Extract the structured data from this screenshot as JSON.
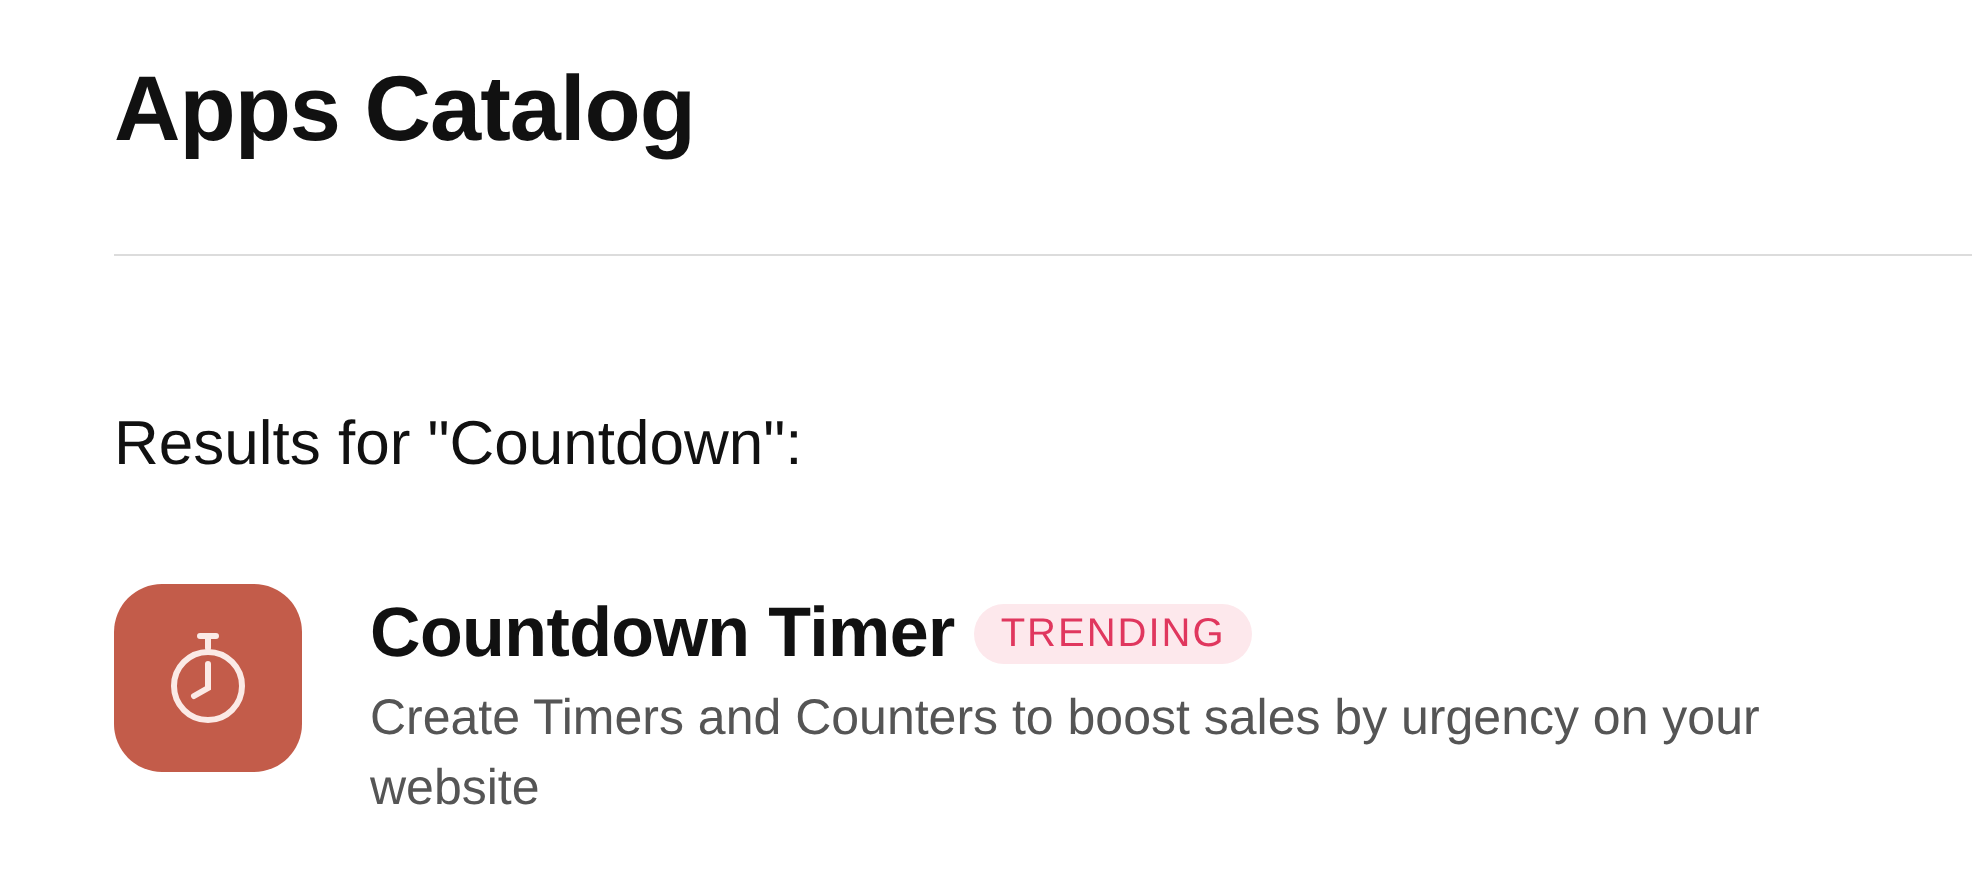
{
  "page": {
    "title": "Apps Catalog"
  },
  "results": {
    "heading": "Results for \"Countdown\":",
    "apps": [
      {
        "name": "Countdown Timer",
        "badge": "TRENDING",
        "description": "Create Timers and Counters to boost sales by urgency on your website"
      }
    ]
  }
}
